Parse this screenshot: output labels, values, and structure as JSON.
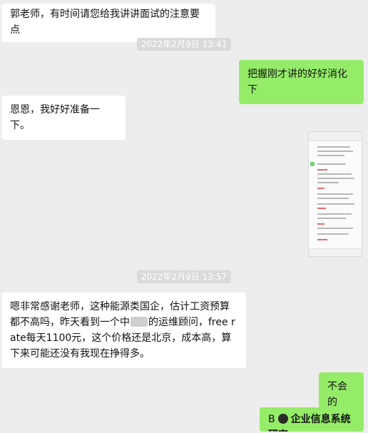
{
  "messages": {
    "m1": "郭老师，有时间请您给我讲讲面试的注意要点",
    "ts1": "2022年2月9日 13:41",
    "m2": "把握刚才讲的好好消化下",
    "m3": "恩恩，我好好准备一下。",
    "ts2": "2022年2月9日 13:57",
    "m4_part1": "嗯非常感谢老师，这种能源类国企，估计工资预算都不高吗，昨天看到一个中",
    "m4_part2": "的运维顾问，free rate每天1100元，这个价格还是北京，成本高，算下来可能还没有我现在挣得多。",
    "m5": "不会的",
    "m6_prefix": "B",
    "watermark": "企业信息系统研究"
  }
}
